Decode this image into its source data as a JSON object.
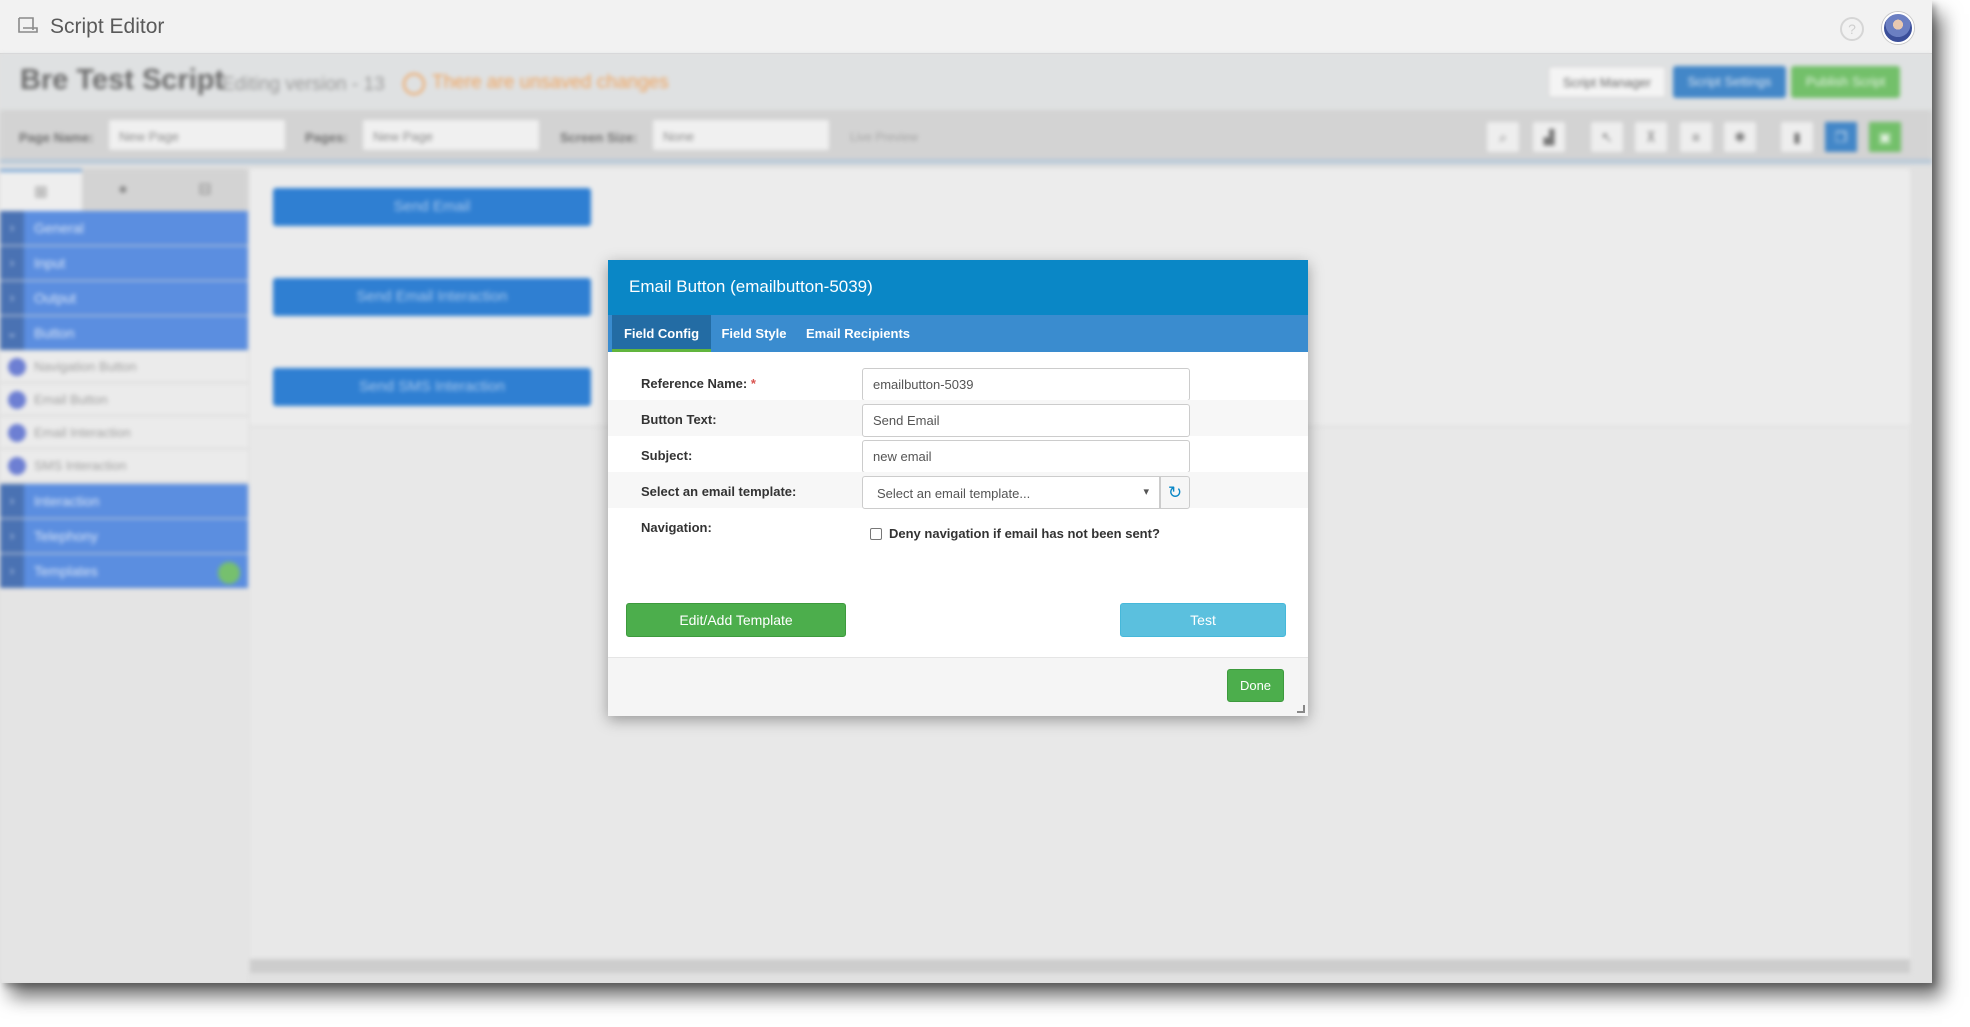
{
  "window": {
    "title": "Script Editor"
  },
  "script": {
    "name": "Bre Test Script",
    "version_text": "Editing version - 13",
    "unsaved_text": "There are unsaved changes",
    "buttons": {
      "script_manager": "Script Manager",
      "script_settings": "Script Settings",
      "publish": "Publish Script"
    }
  },
  "toolbar": {
    "page_name_label": "Page Name:",
    "page_name_value": "New Page",
    "pages_label": "Pages:",
    "pages_value": "New Page",
    "screen_size_label": "Screen Size:",
    "screen_size_value": "None",
    "live_preview": "Live Preview"
  },
  "sidebar": {
    "categories_top": [
      "General",
      "Input",
      "Output",
      "Button"
    ],
    "button_items": [
      "Navigation Button",
      "Email Button",
      "Email Interaction",
      "SMS Interaction"
    ],
    "categories_bottom": [
      "Interaction",
      "Telephony",
      "Templates"
    ]
  },
  "canvas": {
    "buttons": [
      "Send Email",
      "Send Email Interaction",
      "Send SMS Interaction"
    ]
  },
  "modal": {
    "title": "Email Button (emailbutton-5039)",
    "tabs": [
      "Field Config",
      "Field Style",
      "Email Recipients"
    ],
    "fields": {
      "reference_name_label": "Reference Name:",
      "reference_name_required": "*",
      "reference_name_value": "emailbutton-5039",
      "button_text_label": "Button Text:",
      "button_text_value": "Send Email",
      "subject_label": "Subject:",
      "subject_value": "new email",
      "template_label": "Select an email template:",
      "template_placeholder": "Select an email template...",
      "navigation_label": "Navigation:",
      "deny_label": "Deny navigation if email has not been sent?"
    },
    "buttons": {
      "edit_template": "Edit/Add Template",
      "test": "Test",
      "done": "Done"
    }
  }
}
